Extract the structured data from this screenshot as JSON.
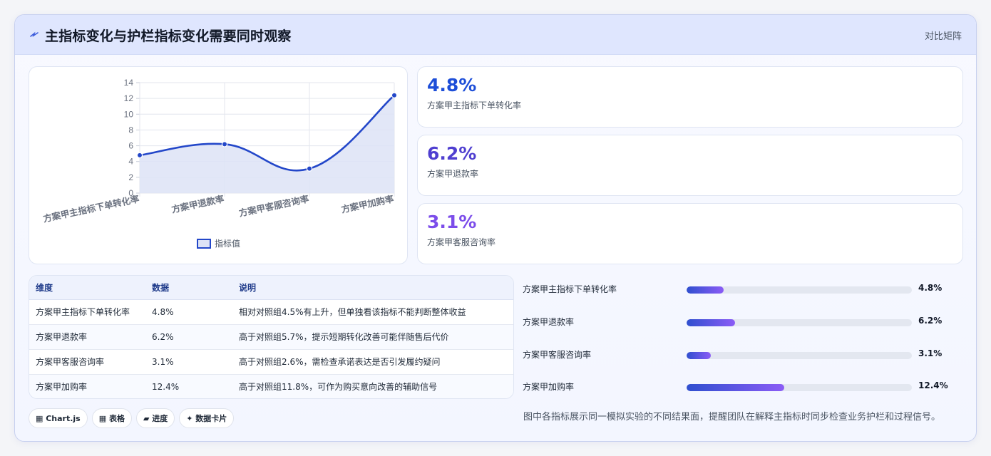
{
  "header": {
    "title": "主指标变化与护栏指标变化需要同时观察",
    "tag": "对比矩阵"
  },
  "kpis": [
    {
      "value": "4.8%",
      "label": "方案甲主指标下单转化率",
      "color": "#1d4ed8"
    },
    {
      "value": "6.2%",
      "label": "方案甲退款率",
      "color": "#4f3fd0"
    },
    {
      "value": "3.1%",
      "label": "方案甲客服咨询率",
      "color": "#7c4dea"
    }
  ],
  "chart_data": {
    "type": "line",
    "categories": [
      "方案甲主指标下单转化率",
      "方案甲退款率",
      "方案甲客服咨询率",
      "方案甲加购率"
    ],
    "series": [
      {
        "name": "指标值",
        "values": [
          4.8,
          6.2,
          3.1,
          12.4
        ]
      }
    ],
    "ylim": [
      0,
      14
    ],
    "yticks": [
      "0",
      "2",
      "4",
      "6",
      "8",
      "10",
      "12",
      "14"
    ],
    "legend": "bottom",
    "grid": true,
    "colors": {
      "line": "#2347c9",
      "fill": "#dde3f6"
    }
  },
  "table": {
    "headers": [
      "维度",
      "数据",
      "说明"
    ],
    "rows": [
      [
        "方案甲主指标下单转化率",
        "4.8%",
        "相对对照组4.5%有上升，但单独看该指标不能判断整体收益"
      ],
      [
        "方案甲退款率",
        "6.2%",
        "高于对照组5.7%，提示短期转化改善可能伴随售后代价"
      ],
      [
        "方案甲客服咨询率",
        "3.1%",
        "高于对照组2.6%，需检查承诺表达是否引发履约疑问"
      ],
      [
        "方案甲加购率",
        "12.4%",
        "高于对照组11.8%，可作为购买意向改善的辅助信号"
      ]
    ]
  },
  "bars": [
    {
      "label": "方案甲主指标下单转化率",
      "value": "4.8%",
      "fraction": 0.165
    },
    {
      "label": "方案甲退款率",
      "value": "6.2%",
      "fraction": 0.215
    },
    {
      "label": "方案甲客服咨询率",
      "value": "3.1%",
      "fraction": 0.107
    },
    {
      "label": "方案甲加购率",
      "value": "12.4%",
      "fraction": 0.435
    }
  ],
  "chips": [
    "▦ Chart.js",
    "▦ 表格",
    "▰ 进度",
    "✦ 数据卡片"
  ],
  "note": "图中各指标展示同一模拟实验的不同结果面，提醒团队在解释主指标时同步检查业务护栏和过程信号。"
}
